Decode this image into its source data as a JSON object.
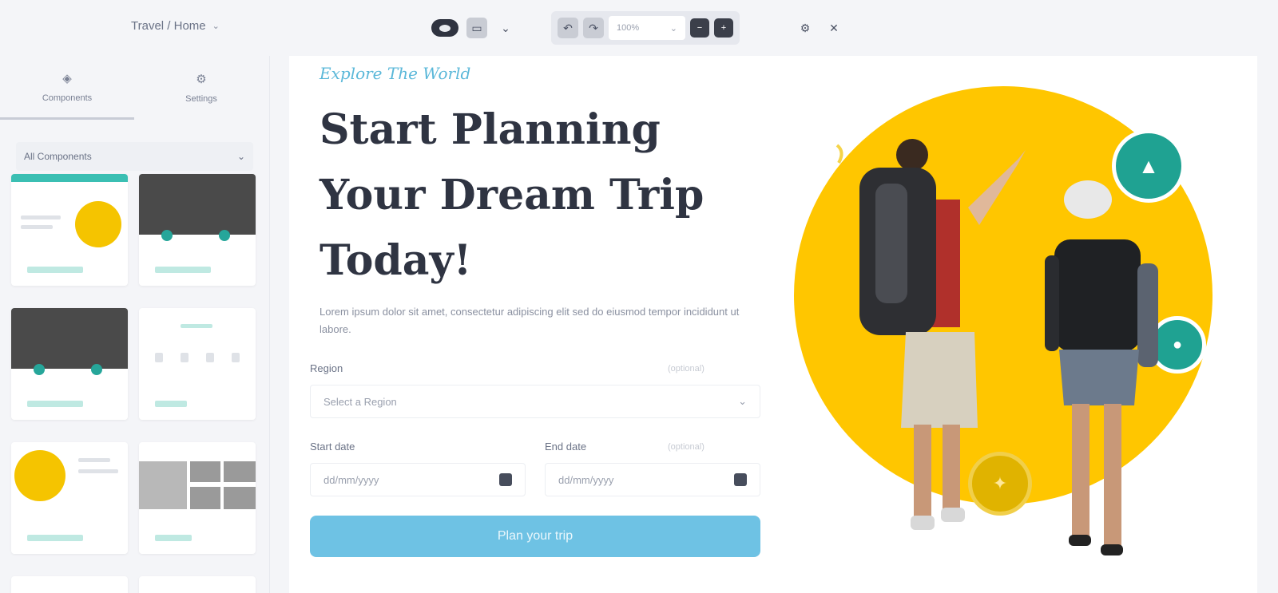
{
  "toolbar": {
    "page_title": "Travel / Home",
    "zoom_label": "100%"
  },
  "sidebar": {
    "tabs": [
      {
        "label": "Components",
        "icon": "layers-icon"
      },
      {
        "label": "Settings",
        "icon": "gear-icon"
      }
    ],
    "category_select": "All Components"
  },
  "canvas": {
    "eyebrow": "Explore The World",
    "headline": "Start Planning Your Dream Trip Today!",
    "description": "Lorem ipsum dolor sit amet, consectetur adipiscing elit sed do eiusmod tempor incididunt ut labore.",
    "region": {
      "label": "Region",
      "placeholder": "Select a Region",
      "hint": "(optional)"
    },
    "start_date": {
      "label": "Start date",
      "placeholder": "dd/mm/yyyy"
    },
    "end_date": {
      "label": "End date",
      "placeholder": "dd/mm/yyyy",
      "hint": "(optional)"
    },
    "cta_label": "Plan your trip"
  },
  "colors": {
    "accent": "#6ec2e4",
    "hero_circle": "#ffc600",
    "badge_teal": "#1fa292"
  }
}
